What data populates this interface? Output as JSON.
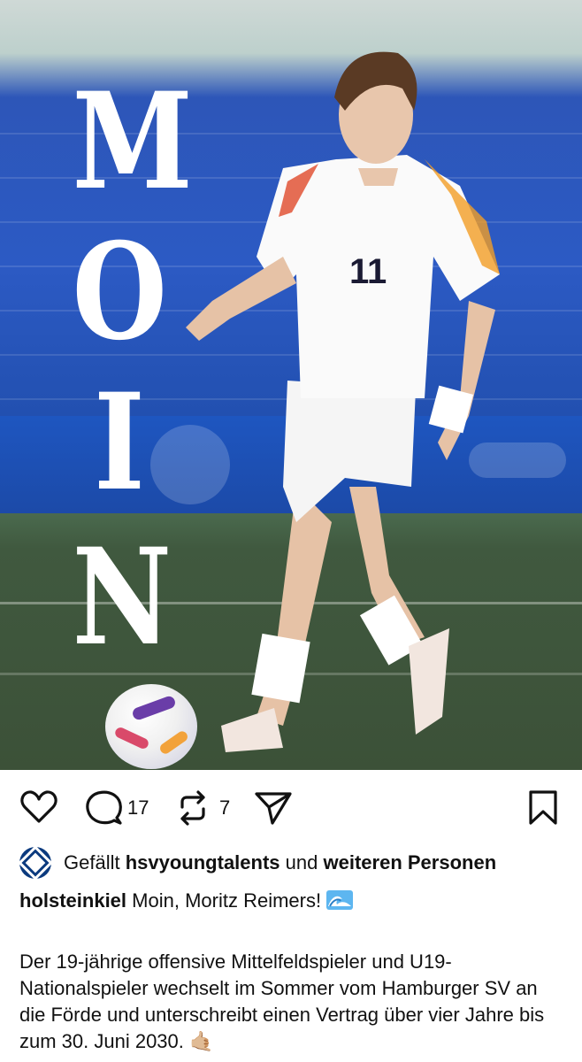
{
  "photo": {
    "overlay_letters": [
      "M",
      "O",
      "I",
      "N"
    ],
    "jersey_number": "11"
  },
  "actions": {
    "like_icon": "heart-outline-icon",
    "comment_icon": "comment-bubble-icon",
    "comment_count": "17",
    "repost_icon": "repost-arrows-icon",
    "repost_count": "7",
    "share_icon": "paper-plane-icon",
    "bookmark_icon": "bookmark-outline-icon"
  },
  "likes": {
    "prefix": "Gefällt",
    "user": "hsvyoungtalents",
    "connector": "und",
    "others": "weiteren Personen"
  },
  "caption": {
    "username": "holsteinkiel",
    "text": "Moin, Moritz Reimers!",
    "emoji": "wave-emoji",
    "body": "Der 19-jährige offensive Mittelfeldspieler und U19-Nationalspieler wechselt im Sommer vom Hamburger SV an die Förde und unterschreibt einen Vertrag über vier Jahre bis zum 30. Juni 2030. 🤙🏼"
  },
  "colors": {
    "accent": "#111111",
    "avatar": "#0b3a7e",
    "stadium_blue": "#2c5ac4",
    "pitch_green": "#3e553b"
  }
}
